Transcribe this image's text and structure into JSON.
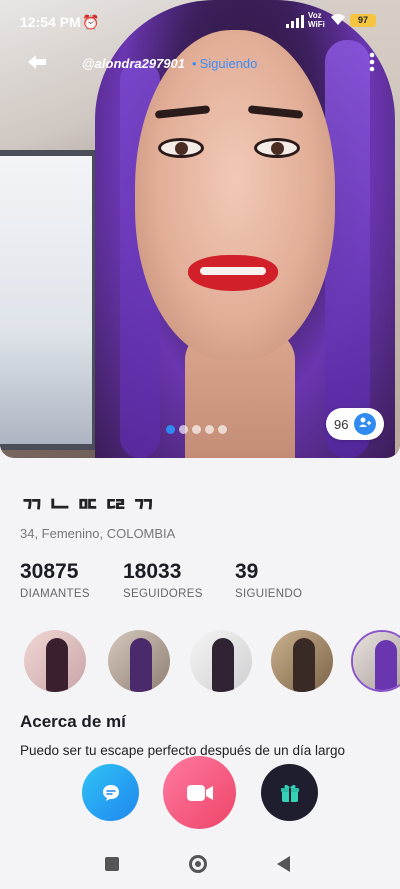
{
  "statusbar": {
    "time": "12:54 PM",
    "alarm_icon": "alarm-icon",
    "network_label": "Voz\nWiFi",
    "battery_level": "97"
  },
  "header": {
    "username": "@alondra297901",
    "following_label": "Siguiendo"
  },
  "carousel": {
    "total_dots": 5,
    "active_index": 0,
    "photo_count": "96"
  },
  "profile": {
    "name": "ᄁᄂᄆᄃᄃᄅᄁ",
    "meta": "34, Femenino, COLOMBIA"
  },
  "stats": [
    {
      "value": "30875",
      "label": "DIAMANTES"
    },
    {
      "value": "18033",
      "label": "SEGUIDORES"
    },
    {
      "value": "39",
      "label": "SIGUIENDO"
    }
  ],
  "about": {
    "title": "Acerca de mí",
    "text": "Puedo ser tu escape perfecto después de un día largo"
  },
  "colors": {
    "accent_blue": "#2f8bf2",
    "video_pink": "#ee4468",
    "chat_blue": "#1f86ef",
    "gift_dark": "#1f1e2e"
  }
}
